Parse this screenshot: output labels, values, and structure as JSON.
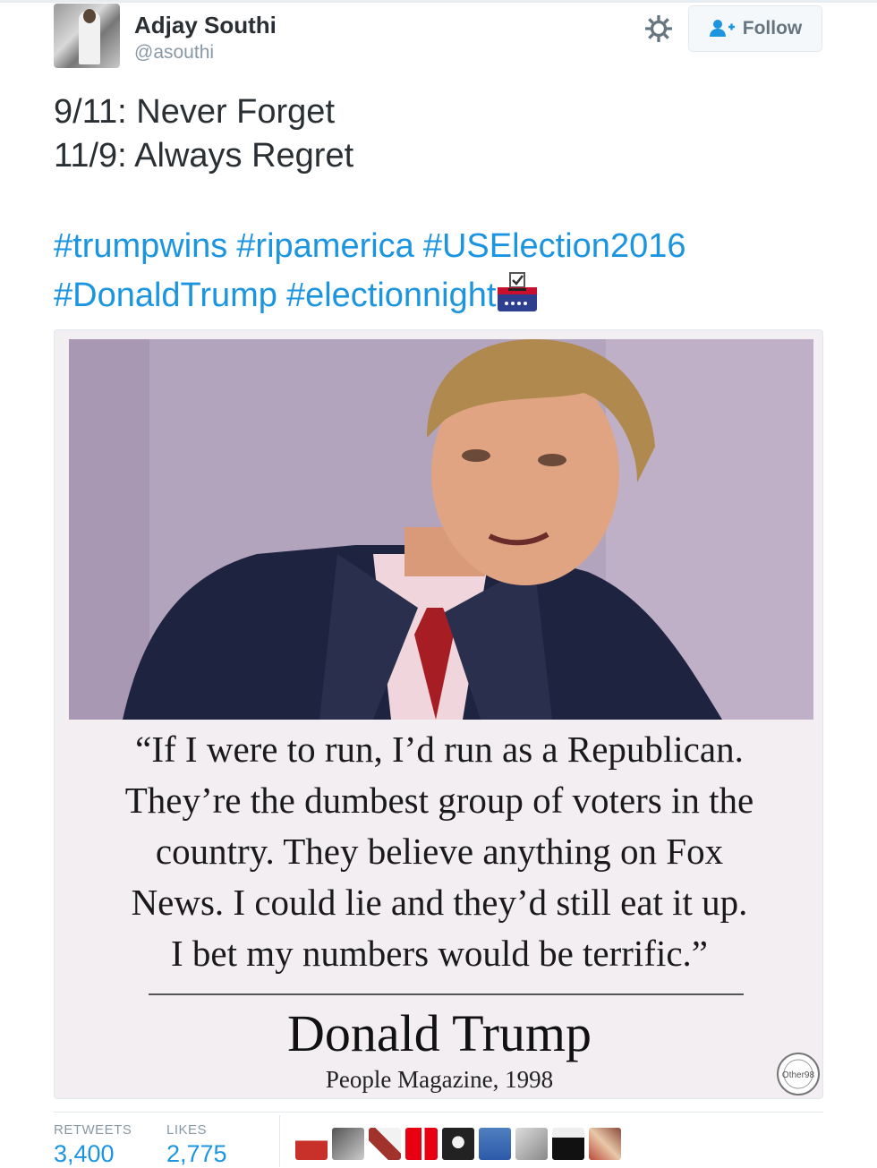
{
  "user": {
    "name": "Adjay Southi",
    "handle": "@asouthi"
  },
  "actions": {
    "follow_label": "Follow"
  },
  "tweet": {
    "lines": [
      "9/11: Never Forget",
      "11/9: Always Regret"
    ],
    "hashtags": [
      "#trumpwins",
      "#ripamerica",
      "#USElection2016",
      "#DonaldTrump",
      "#electionnight"
    ]
  },
  "media": {
    "quote_lines": [
      "“If I were to run, I’d run as a Republican.",
      "They’re the dumbest group of voters in the",
      "country. They believe anything on Fox",
      "News. I could lie and they’d still eat it up.",
      "I bet my numbers would be terrific.”"
    ],
    "author": "Donald Trump",
    "source": "People Magazine, 1998",
    "stamp_text": "Other98"
  },
  "stats": {
    "retweets_label": "RETWEETS",
    "retweets": "3,400",
    "likes_label": "LIKES",
    "likes": "2,775"
  },
  "colors": {
    "link": "#1b95e0",
    "muted": "#8899a6",
    "text": "#292f33"
  },
  "likers": [
    "liker-avatar",
    "liker-avatar",
    "liker-avatar",
    "liker-avatar",
    "liker-avatar",
    "liker-avatar",
    "liker-avatar",
    "liker-avatar",
    "liker-avatar",
    "liker-avatar"
  ]
}
